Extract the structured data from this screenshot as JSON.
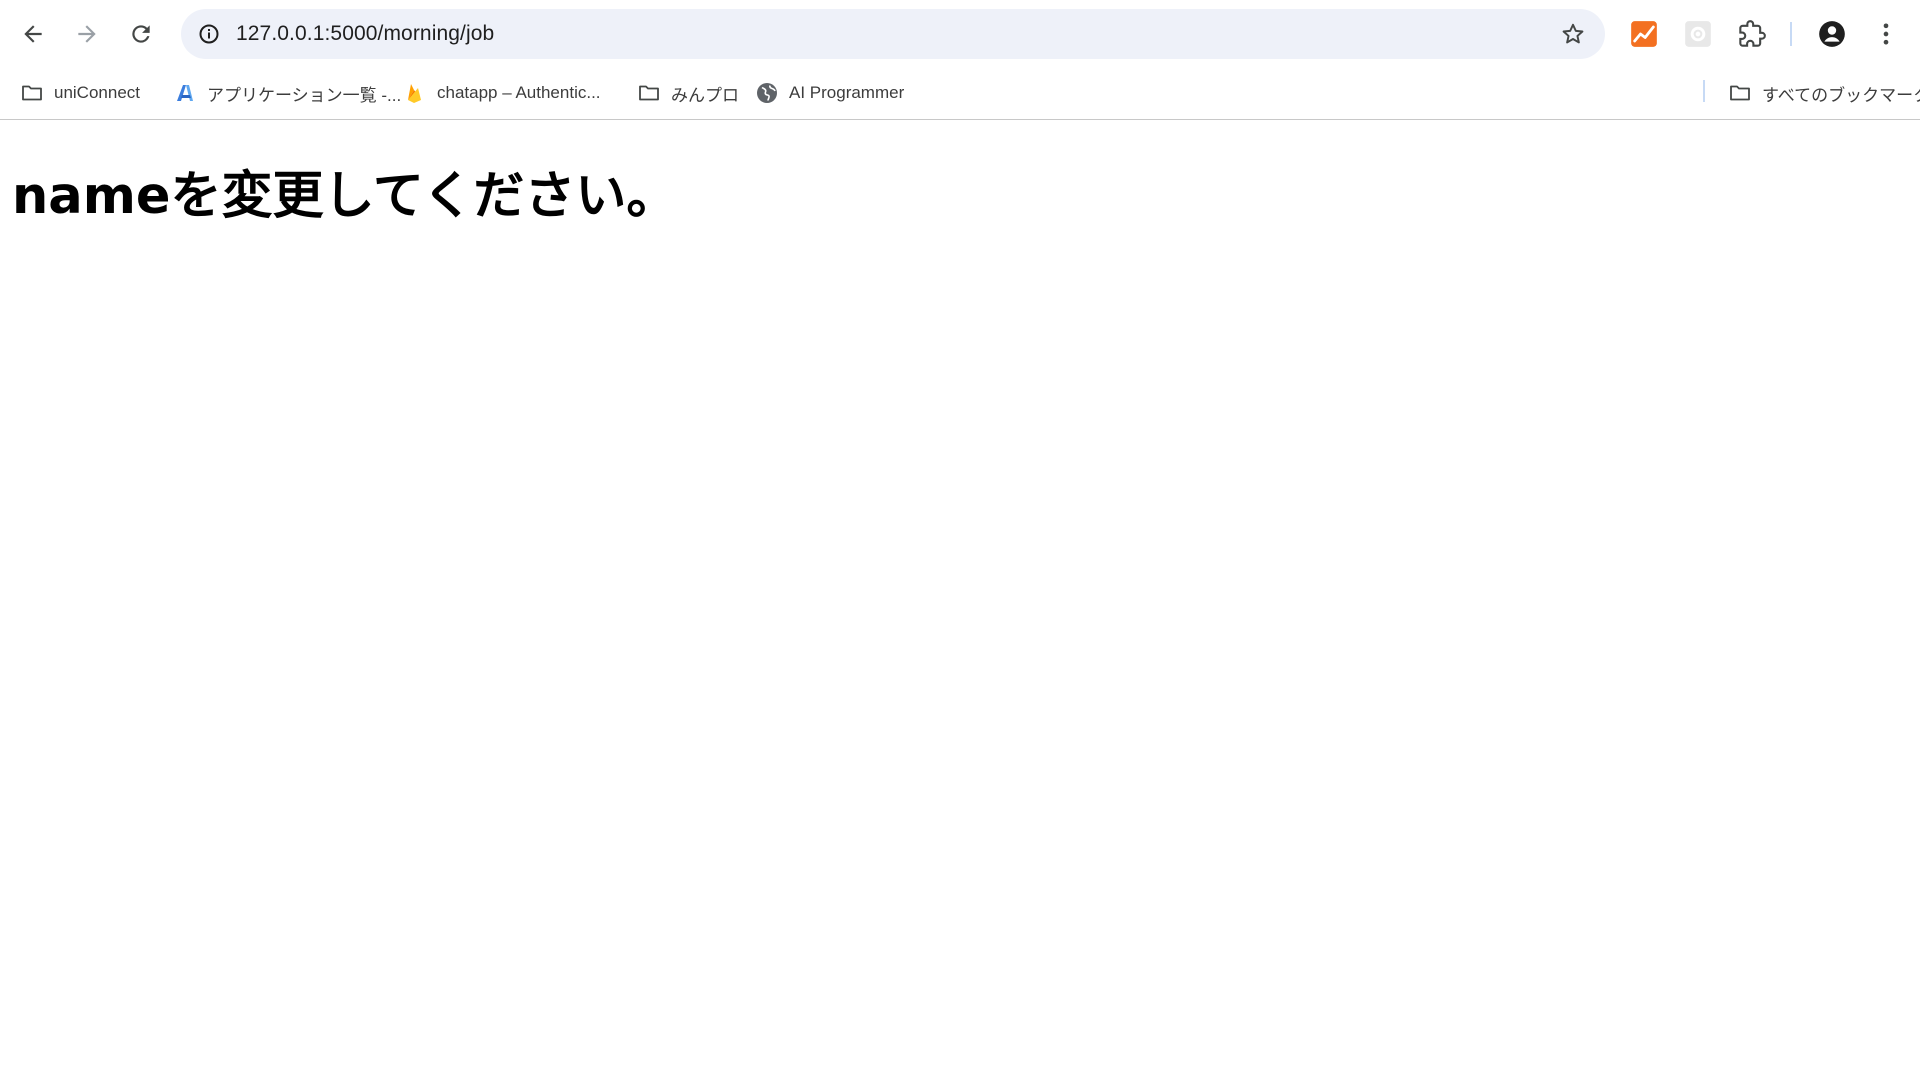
{
  "browser": {
    "url": "127.0.0.1:5000/morning/job",
    "icons": {
      "back": "arrow-left-icon",
      "forward": "arrow-right-icon",
      "reload": "reload-icon",
      "site_info": "info-circle-icon",
      "bookmark_star": "star-icon",
      "extension_1": "chart-extension-icon",
      "extension_2": "gear-extension-icon",
      "extensions": "puzzle-icon",
      "profile": "account-icon",
      "menu": "kebab-menu-icon"
    }
  },
  "bookmarks": {
    "items": [
      {
        "label": "uniConnect",
        "icon": "folder-icon"
      },
      {
        "label": "アプリケーション一覧 -...",
        "icon": "azure-icon"
      },
      {
        "label": "chatapp – Authentic...",
        "icon": "firebase-icon"
      },
      {
        "label": "みんプロ",
        "icon": "folder-icon"
      },
      {
        "label": "AI Programmer",
        "icon": "globe-icon"
      }
    ],
    "all_bookmarks": {
      "label": "すべてのブックマーク",
      "icon": "folder-icon"
    }
  },
  "page": {
    "heading": "nameを変更してください。"
  },
  "colors": {
    "omnibox_bg": "#eef1f9",
    "extension_orange": "#f37021"
  }
}
